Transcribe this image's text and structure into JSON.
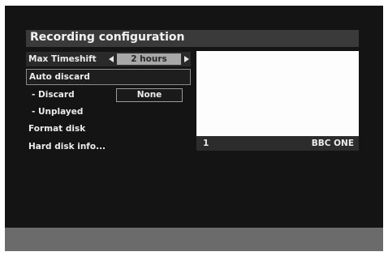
{
  "screen": {
    "title": "Recording configuration"
  },
  "menu": {
    "max_timeshift": {
      "label": "Max Timeshift",
      "value": "2 hours"
    },
    "auto_discard": {
      "label": "Auto discard"
    },
    "discard": {
      "label": "- Discard",
      "value": "None"
    },
    "unplayed": {
      "label": "- Unplayed"
    },
    "format_disk": {
      "label": "Format disk"
    },
    "hard_disk_info": {
      "label": "Hard disk info..."
    }
  },
  "preview": {
    "channel_number": "1",
    "channel_name": "BBC ONE"
  },
  "icons": [
    "arrow-left-icon",
    "arrow-right-icon"
  ]
}
